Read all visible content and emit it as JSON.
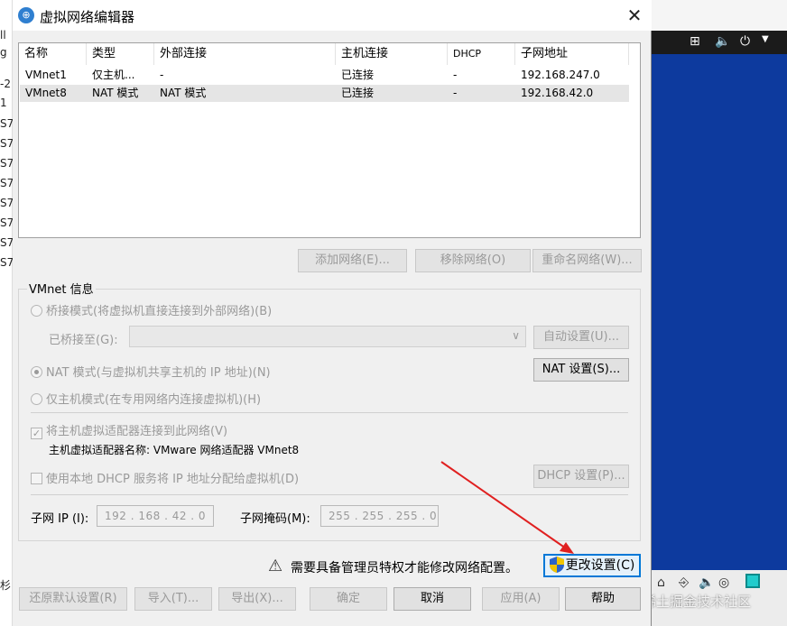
{
  "dialog": {
    "title": "虚拟网络编辑器",
    "close_glyph": "✕"
  },
  "network_list": {
    "headers": [
      "名称",
      "类型",
      "外部连接",
      "主机连接",
      "DHCP",
      "子网地址"
    ],
    "rows": [
      [
        "VMnet1",
        "仅主机...",
        "-",
        "已连接",
        "-",
        "192.168.247.0"
      ],
      [
        "VMnet8",
        "NAT 模式",
        "NAT 模式",
        "已连接",
        "-",
        "192.168.42.0"
      ]
    ]
  },
  "list_buttons": {
    "add": "添加网络(E)...",
    "remove": "移除网络(O)",
    "rename": "重命名网络(W)..."
  },
  "vmnet_info": {
    "group_label": "VMnet 信息",
    "bridge_mode": "桥接模式(将虚拟机直接连接到外部网络)(B)",
    "bridged_to_label": "已桥接至(G):",
    "bridged_to_value": "",
    "auto_settings": "自动设置(U)...",
    "nat_mode": "NAT 模式(与虚拟机共享主机的 IP 地址)(N)",
    "nat_settings": "NAT 设置(S)...",
    "host_only_mode": "仅主机模式(在专用网络内连接虚拟机)(H)",
    "connect_adapter": "将主机虚拟适配器连接到此网络(V)",
    "adapter_name": "主机虚拟适配器名称: VMware 网络适配器 VMnet8",
    "use_dhcp": "使用本地 DHCP 服务将 IP 地址分配给虚拟机(D)",
    "dhcp_settings": "DHCP 设置(P)...",
    "subnet_ip_label": "子网 IP (I):",
    "subnet_ip_value": "192 . 168 . 42  .  0",
    "subnet_mask_label": "子网掩码(M):",
    "subnet_mask_value": "255 . 255 . 255 .  0"
  },
  "warning": {
    "text": "需要具备管理员特权才能修改网络配置。",
    "change_settings": "更改设置(C)"
  },
  "footer_buttons": {
    "restore": "还原默认设置(R)",
    "import": "导入(T)...",
    "export": "导出(X)...",
    "ok": "确定",
    "cancel": "取消",
    "apply": "应用(A)",
    "help": "帮助"
  },
  "background": {
    "left_edge_text": [
      "ll",
      "g",
      "-2",
      "1",
      "S7",
      "S7",
      "S7",
      "S7",
      "S7",
      "S7",
      "S7",
      "S7",
      "杉"
    ],
    "watermark": "@稀土掘金技术社区"
  },
  "colors": {
    "accent": "#0078d7",
    "desktop_blue": "#0d3a9e",
    "annotation_arrow": "#e02020"
  }
}
